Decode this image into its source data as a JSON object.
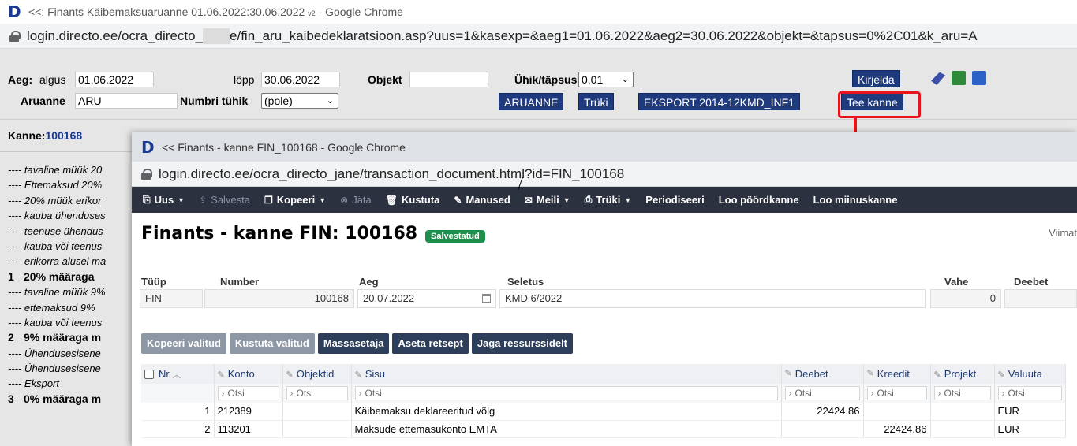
{
  "bg_window": {
    "title": "<<: Finants Käibemaksuaruanne 01.06.2022:30.06.2022",
    "title_suffix": "v2",
    "title_app": " - Google Chrome",
    "url_part1": "login.directo.ee/ocra_directo_",
    "url_part2": "e/fin_aru_kaibedeklaratsioon.asp?uus=1&kasexp=&aeg1=01.06.2022&aeg2=30.06.2022&objekt=&tapsus=0%2C01&k_aru=A"
  },
  "form": {
    "aeg_label": "Aeg:",
    "algus_label": "algus",
    "algus_value": "01.06.2022",
    "lopp_label": "lõpp",
    "lopp_value": "30.06.2022",
    "objekt_label": "Objekt",
    "objekt_value": "",
    "uhik_label": "Ühik/täpsus",
    "uhik_value": "0,01",
    "aruanne_label": "Aruanne",
    "aruanne_value": "ARU",
    "numbri_label": "Numbri tühik",
    "numbri_value": "(pole)",
    "btn_kirjelda": "Kirjelda",
    "btn_aruanne": "ARUANNE",
    "btn_truki": "Trüki",
    "btn_eksport": "EKSPORT 2014-12KMD_INF1",
    "btn_tee_kanne": "Tee kanne"
  },
  "bg_left": {
    "kanne_label": "Kanne:",
    "kanne_number": "100168",
    "lines": [
      {
        "text": "---- tavaline müük 20",
        "bold": false,
        "num": ""
      },
      {
        "text": "---- Ettemaksud 20%",
        "bold": false,
        "num": ""
      },
      {
        "text": "---- 20% müük erikor",
        "bold": false,
        "num": ""
      },
      {
        "text": "---- kauba ühenduses",
        "bold": false,
        "num": ""
      },
      {
        "text": "---- teenuse ühendus",
        "bold": false,
        "num": ""
      },
      {
        "text": "---- kauba või teenus",
        "bold": false,
        "num": ""
      },
      {
        "text": "---- erikorra alusel ma",
        "bold": false,
        "num": ""
      },
      {
        "text": "20% määraga",
        "bold": true,
        "num": "1"
      },
      {
        "text": "---- tavaline müük 9%",
        "bold": false,
        "num": ""
      },
      {
        "text": "---- ettemaksud 9%",
        "bold": false,
        "num": ""
      },
      {
        "text": "---- kauba või teenus",
        "bold": false,
        "num": ""
      },
      {
        "text": "9% määraga m",
        "bold": true,
        "num": "2"
      },
      {
        "text": "---- Ühendusesisene",
        "bold": false,
        "num": ""
      },
      {
        "text": "---- Ühendusesisene",
        "bold": false,
        "num": ""
      },
      {
        "text": "---- Eksport",
        "bold": false,
        "num": ""
      },
      {
        "text": "0% määraga m",
        "bold": true,
        "num": "3"
      }
    ]
  },
  "popup": {
    "title": "<< Finants - kanne FIN_100168 - Google Chrome",
    "url": "login.directo.ee/ocra_directo_jane/transaction_document.html?id=FIN_100168",
    "toolbar": [
      {
        "label": "Uus",
        "icon": "new-icon",
        "glyph": "⎘",
        "caret": true,
        "disabled": false
      },
      {
        "label": "Salvesta",
        "icon": "save-icon",
        "glyph": "⇪",
        "caret": false,
        "disabled": true
      },
      {
        "label": "Kopeeri",
        "icon": "copy-icon",
        "glyph": "❐",
        "caret": true,
        "disabled": false
      },
      {
        "label": "Jäta",
        "icon": "cancel-icon",
        "glyph": "⊗",
        "caret": false,
        "disabled": true
      },
      {
        "label": "Kustuta",
        "icon": "trash-icon",
        "glyph": "🗑",
        "caret": false,
        "disabled": false
      },
      {
        "label": "Manused",
        "icon": "paperclip-icon",
        "glyph": "✎",
        "caret": false,
        "disabled": false
      },
      {
        "label": "Meili",
        "icon": "mail-icon",
        "glyph": "✉",
        "caret": true,
        "disabled": false
      },
      {
        "label": "Trüki",
        "icon": "print-icon",
        "glyph": "⎙",
        "caret": true,
        "disabled": false
      },
      {
        "label": "Periodiseeri",
        "icon": "",
        "glyph": "",
        "caret": false,
        "disabled": false
      },
      {
        "label": "Loo pöördkanne",
        "icon": "",
        "glyph": "",
        "caret": false,
        "disabled": false
      },
      {
        "label": "Loo miinuskanne",
        "icon": "",
        "glyph": "",
        "caret": false,
        "disabled": false
      }
    ],
    "doc_title": "Finants - kanne FIN: 100168",
    "status_badge": "Salvestatud",
    "viimati": "Viimat",
    "fields": {
      "tyyp_label": "Tüüp",
      "tyyp_value": "FIN",
      "number_label": "Number",
      "number_value": "100168",
      "aeg_label": "Aeg",
      "aeg_value": "20.07.2022",
      "seletus_label": "Seletus",
      "seletus_value": "KMD 6/2022",
      "vahe_label": "Vahe",
      "vahe_value": "0",
      "deebet_label": "Deebet",
      "deebet_value": ""
    },
    "actions": [
      {
        "label": "Kopeeri valitud",
        "disabled": true
      },
      {
        "label": "Kustuta valitud",
        "disabled": true
      },
      {
        "label": "Massasetaja",
        "disabled": false
      },
      {
        "label": "Aseta retsept",
        "disabled": false
      },
      {
        "label": "Jaga ressurssidelt",
        "disabled": false
      }
    ],
    "grid": {
      "headers": {
        "nr": "Nr",
        "konto": "Konto",
        "objektid": "Objektid",
        "sisu": "Sisu",
        "deebet": "Deebet",
        "kreedit": "Kreedit",
        "projekt": "Projekt",
        "valuuta": "Valuuta"
      },
      "filter_placeholder": "Otsi",
      "rows": [
        {
          "nr": "1",
          "konto": "212389",
          "objektid": "",
          "sisu": "Käibemaksu deklareeritud võlg",
          "deebet": "22424.86",
          "kreedit": "",
          "projekt": "",
          "valuuta": "EUR"
        },
        {
          "nr": "2",
          "konto": "113201",
          "objektid": "",
          "sisu": "Maksude ettemasukonto EMTA",
          "deebet": "",
          "kreedit": "22424.86",
          "projekt": "",
          "valuuta": "EUR"
        }
      ]
    }
  },
  "colors": {
    "accent_dark": "#1f3b7d",
    "highlight_red": "#e8141c",
    "status_green": "#1c8f4d",
    "toolbar_bg": "#2c3140"
  }
}
